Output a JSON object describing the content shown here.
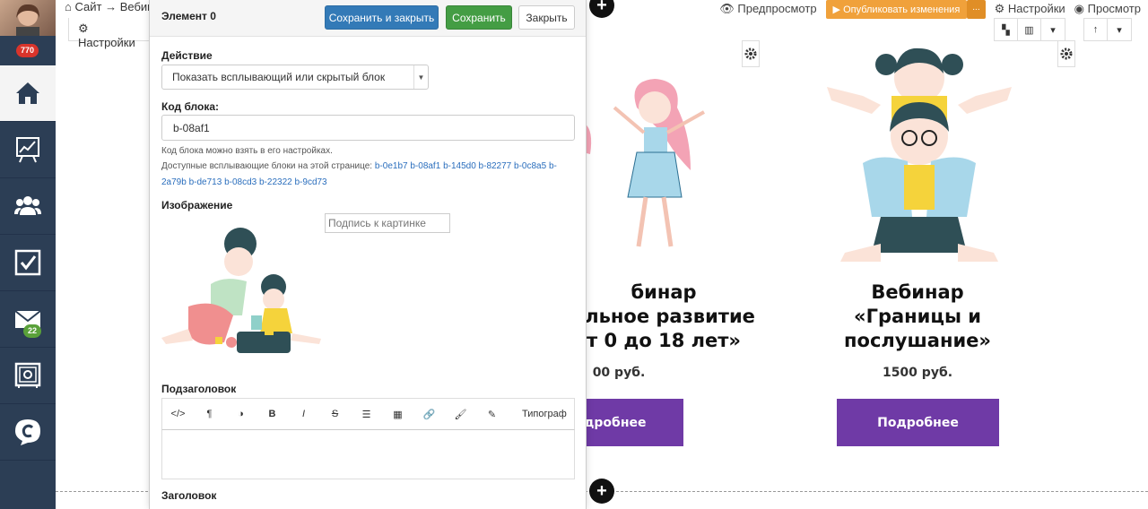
{
  "sidebar": {
    "notifications_badge": "770",
    "mail_badge": "22",
    "items": [
      {
        "name": "home"
      },
      {
        "name": "stats"
      },
      {
        "name": "users"
      },
      {
        "name": "tasks"
      },
      {
        "name": "mail"
      },
      {
        "name": "safe"
      },
      {
        "name": "chat"
      }
    ]
  },
  "topbar": {
    "breadcrumb": "Сайт → Вебин",
    "settings_chip": "Настройки",
    "preview": "Предпросмотр",
    "publish": "▶ Опубликовать изменения",
    "publish_more": "...",
    "settings": "Настройки",
    "view": "Просмотр"
  },
  "modal": {
    "title": "Элемент 0",
    "save_close": "Сохранить и закрыть",
    "save": "Сохранить",
    "close": "Закрыть",
    "action_label": "Действие",
    "action_value": "Показать всплывающий или скрытый блок",
    "block_code_label": "Код блока:",
    "block_code_value": "b-08af1",
    "help_text": "Код блока можно взять в его настройках.",
    "available_prefix": "Доступные всплывающие блоки на этой странице:",
    "available_blocks": [
      "b-0e1b7",
      "b-08af1",
      "b-145d0",
      "b-82277",
      "b-0c8a5",
      "b-2a79b",
      "b-de713",
      "b-08cd3",
      "b-22322",
      "b-9cd73"
    ],
    "image_label": "Изображение",
    "caption_placeholder": "Подпись к картинке",
    "subtitle_label": "Подзаголовок",
    "toolbar_typograph": "Типограф",
    "heading_label": "Заголовок"
  },
  "cards": [
    {
      "title_lines": [
        "бинар",
        "альное развитие",
        "т 0 до 18 лет»"
      ],
      "price": "00 руб.",
      "button": "одробнее"
    },
    {
      "title_lines": [
        "Вебинар",
        "«Границы и",
        "послушание»"
      ],
      "price": "1500 руб.",
      "button": "Подробнее"
    }
  ],
  "colors": {
    "sidebar": "#2c3e55",
    "primary": "#337ab7",
    "success": "#449d44",
    "publish": "#f0a13b",
    "card_button": "#6f3aa6"
  }
}
